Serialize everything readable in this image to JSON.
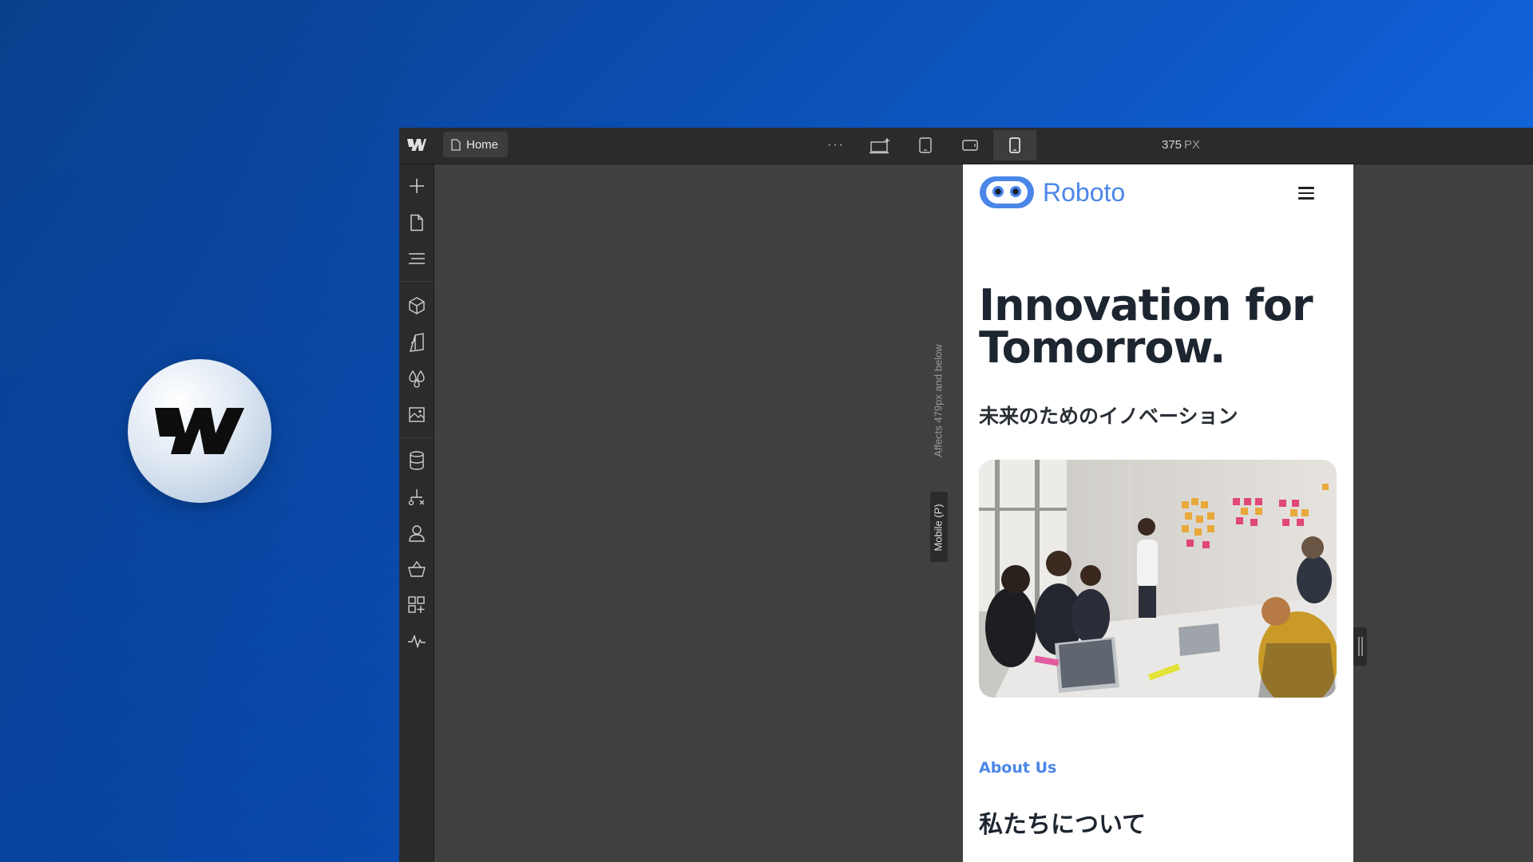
{
  "colors": {
    "accent": "#4a86e8",
    "toolbar_bg": "#2b2b2b",
    "canvas_bg": "#404040",
    "brand_bg": "#0b4fb3"
  },
  "topbar": {
    "page_tab_label": "Home",
    "page_tab_icon": "page-icon",
    "more_icon": "ellipsis-icon",
    "breakpoints": [
      {
        "icon": "desktop-large-icon"
      },
      {
        "icon": "tablet-icon"
      },
      {
        "icon": "mobile-landscape-icon"
      },
      {
        "icon": "mobile-portrait-icon",
        "active": true
      }
    ],
    "width_value": "375",
    "width_unit": "PX"
  },
  "sidebar": {
    "items": [
      {
        "icon": "add-icon"
      },
      {
        "icon": "pages-icon"
      },
      {
        "icon": "navigator-icon"
      },
      {
        "icon": "components-icon"
      },
      {
        "icon": "style-manager-icon"
      },
      {
        "icon": "variables-icon"
      },
      {
        "icon": "assets-icon"
      },
      {
        "icon": "cms-icon"
      },
      {
        "icon": "logic-icon"
      },
      {
        "icon": "users-icon"
      },
      {
        "icon": "ecommerce-icon"
      },
      {
        "icon": "apps-icon"
      },
      {
        "icon": "audits-icon"
      }
    ]
  },
  "canvas": {
    "breakpoint_label": "Mobile (P)",
    "breakpoint_note": "Affects 479px and below"
  },
  "site": {
    "brand": "Roboto",
    "hero_title_line1": "Innovation for",
    "hero_title_line2": "Tomorrow.",
    "hero_subtitle": "未来のためのイノベーション",
    "about_label": "About Us",
    "about_title": "私たちについて"
  }
}
